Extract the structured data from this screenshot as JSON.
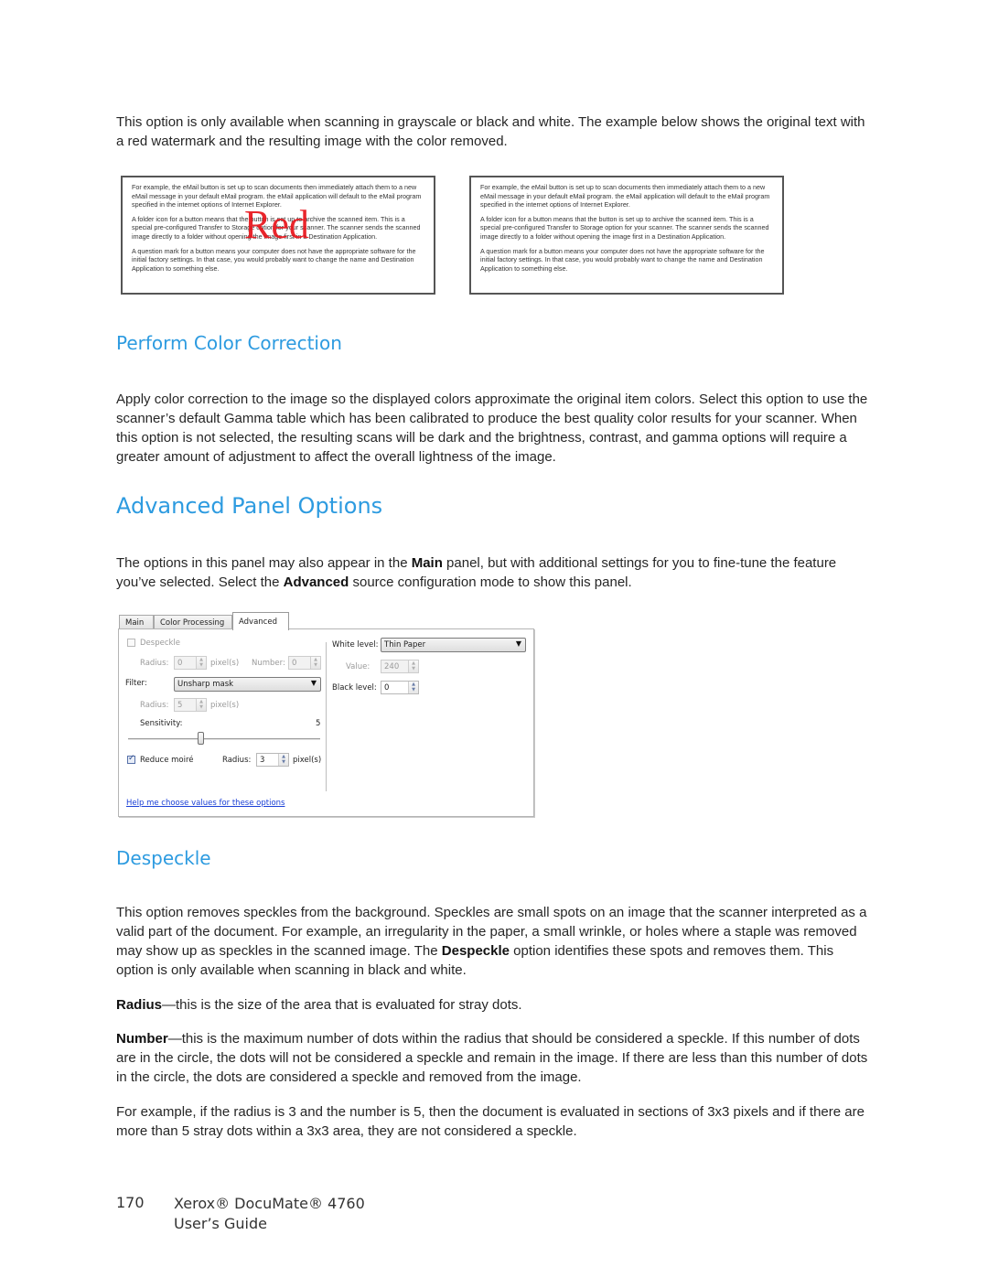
{
  "intro_paragraph": "This option is only available when scanning in grayscale or black and white. The example below shows the original text with a red watermark and the resulting image with the color removed.",
  "sample_images": {
    "paragraphs": [
      "For example, the eMail button is set up to scan documents then immediately attach them to a new eMail message in your default eMail program. the eMail application will default to the eMail program specified in the internet options of Internet Explorer.",
      "A folder icon for a button means that the button is set up to archive the scanned item. This is a special pre-configured Transfer to Storage option for your scanner. The scanner sends the scanned image directly to a folder without opening the image first in a Destination Application.",
      "A question mark for a button means your computer does not have the appropriate software for the initial factory settings. In that case, you would probably want to change the name and Destination Application to something else."
    ],
    "watermark_text": "Red",
    "watermark_color": "#e8141b"
  },
  "color_correction": {
    "heading": "Perform Color Correction",
    "body": "Apply color correction to the image so the displayed colors approximate the original item colors. Select this option to use the scanner’s default Gamma table which has been calibrated to produce the best quality color results for your scanner. When this option is not selected, the resulting scans will be dark and the brightness, contrast, and gamma options will require a greater amount of adjustment to affect the overall lightness of the image."
  },
  "advanced_panel": {
    "heading": "Advanced Panel Options",
    "body_pre": "The options in this panel may also appear in the ",
    "body_bold1": "Main",
    "body_mid": " panel, but with additional settings for you to fine-tune the feature you’ve selected. Select the ",
    "body_bold2": "Advanced",
    "body_post": " source configuration mode to show this panel."
  },
  "dialog": {
    "tabs": [
      {
        "label": "Main",
        "active": false
      },
      {
        "label": "Color Processing",
        "active": false
      },
      {
        "label": "Advanced",
        "active": true
      }
    ],
    "despeckle": {
      "label": "Despeckle",
      "checked": false,
      "enabled": false
    },
    "despeckle_radius": {
      "label": "Radius:",
      "value": "0",
      "unit": "pixel(s)"
    },
    "despeckle_number": {
      "label": "Number:",
      "value": "0"
    },
    "filter": {
      "label": "Filter:",
      "value": "Unsharp mask"
    },
    "filter_radius": {
      "label": "Radius:",
      "value": "5",
      "unit": "pixel(s)"
    },
    "sensitivity": {
      "label": "Sensitivity:",
      "value": "5"
    },
    "reduce_moire": {
      "label": "Reduce moiré",
      "checked": true
    },
    "moire_radius": {
      "label": "Radius:",
      "value": "3",
      "unit": "pixel(s)"
    },
    "white_level": {
      "label": "White level:",
      "value": "Thin Paper"
    },
    "value_field": {
      "label": "Value:",
      "value": "240"
    },
    "black_level": {
      "label": "Black level:",
      "value": "0"
    },
    "help_link": "Help me choose values for these options",
    "arrow_down": "▼",
    "spin_up": "▲",
    "spin_down": "▼"
  },
  "despeckle_section": {
    "heading": "Despeckle",
    "body_pre": "This option removes speckles from the background. Speckles are small spots on an image that the scanner interpreted as a valid part of the document. For example, an irregularity in the paper, a small wrinkle, or holes where a staple was removed may show up as speckles in the scanned image. The ",
    "body_bold": "Despeckle",
    "body_post": " option identifies these spots and removes them. This option is only available when scanning in black and white.",
    "radius_term": "Radius",
    "radius_def": "—this is the size of the area that is evaluated for stray dots.",
    "number_term": "Number",
    "number_def": "—this is the maximum number of dots within the radius that should be considered a speckle. If this number of dots are in the circle, the dots will not be considered a speckle and remain in the image. If there are less than this number of dots in the circle, the dots are considered a speckle and removed from the image.",
    "example": "For example, if the radius is 3 and the number is 5, then the document is evaluated in sections of 3x3 pixels and if there are more than 5 stray dots within a 3x3 area, they are not considered a speckle."
  },
  "footer": {
    "page_number": "170",
    "title_line1": "Xerox® DocuMate® 4760",
    "title_line2": "User’s Guide"
  }
}
